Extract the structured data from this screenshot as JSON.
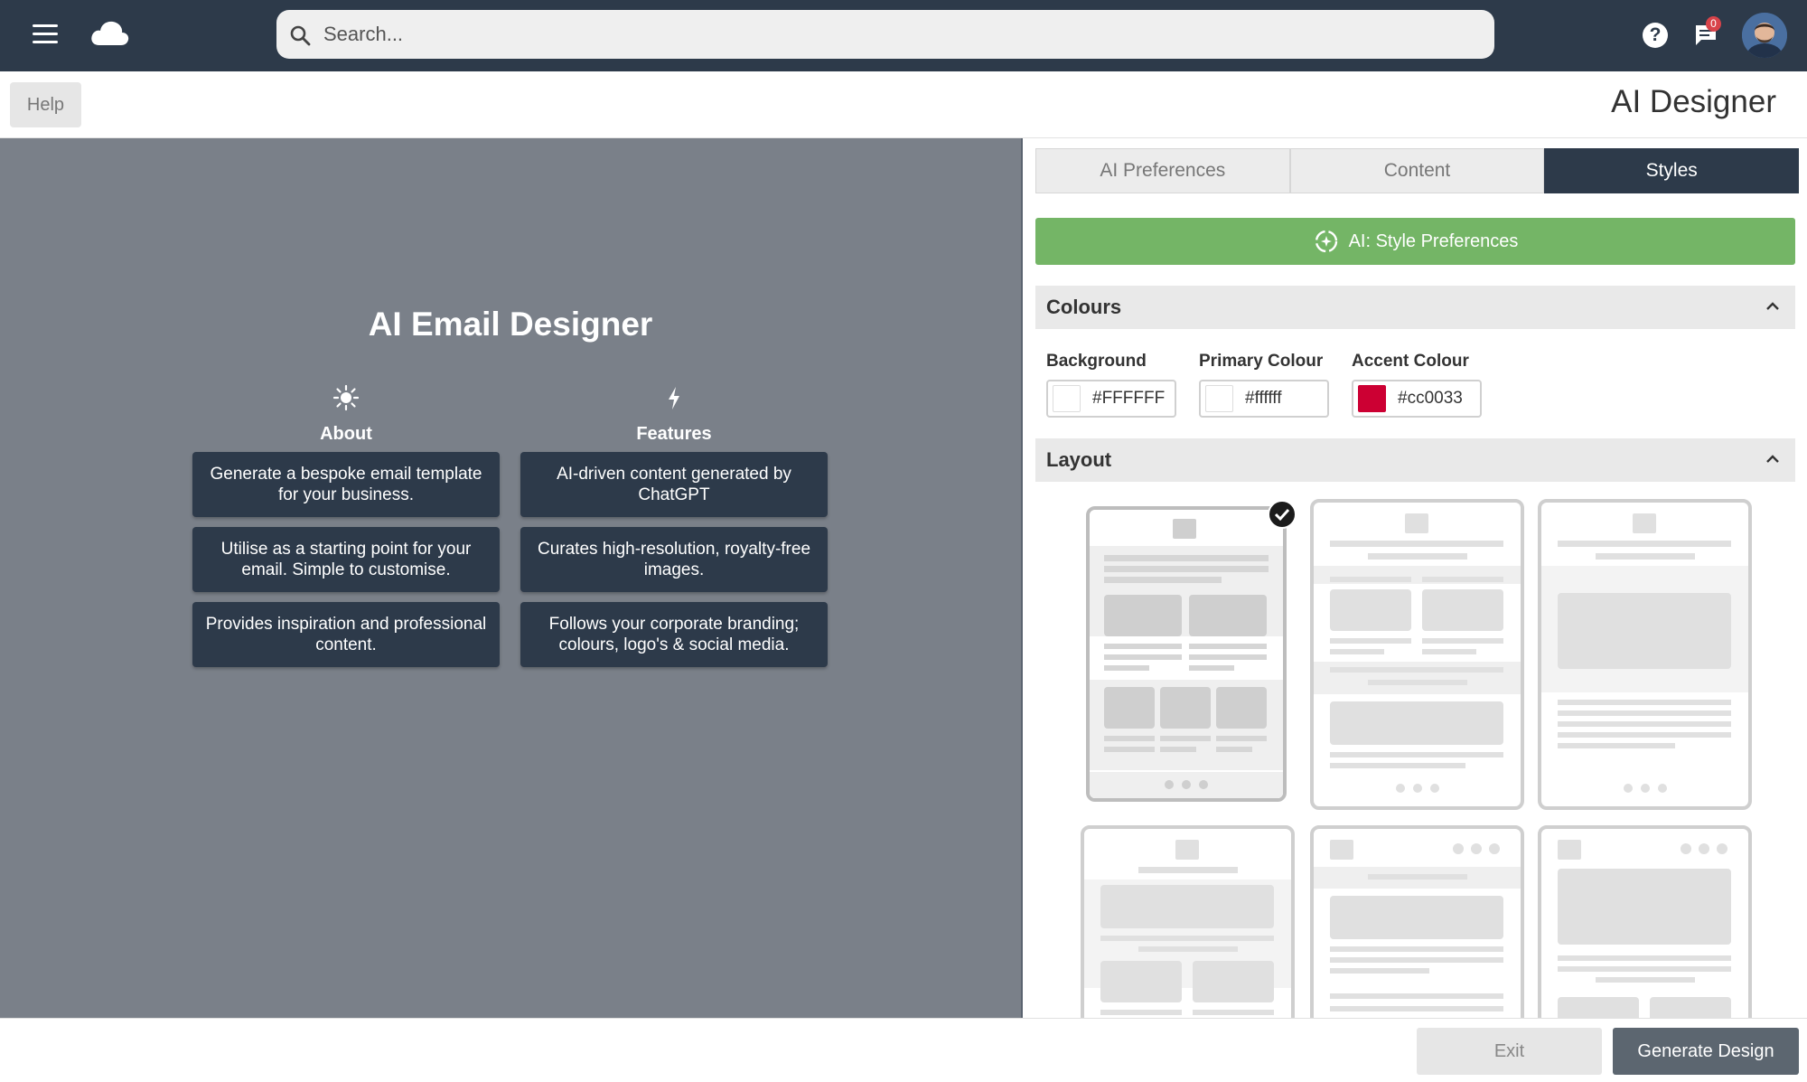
{
  "topbar": {
    "search_placeholder": "Search...",
    "help_glyph": "?",
    "notifications_count": "0",
    "icons": [
      "menu-icon",
      "cloud-logo-icon",
      "search-icon",
      "help-icon",
      "chat-icon",
      "avatar"
    ]
  },
  "subheader": {
    "help_label": "Help",
    "title": "AI Designer"
  },
  "preview": {
    "title": "AI Email Designer",
    "about": {
      "heading": "About",
      "icon": "sun-icon",
      "items": [
        "Generate a bespoke email template for your business.",
        "Utilise as a starting point for your email. Simple to customise.",
        "Provides inspiration and professional content."
      ]
    },
    "features": {
      "heading": "Features",
      "icon": "lightning-icon",
      "items": [
        "AI-driven content generated by ChatGPT",
        "Curates high-resolution, royalty-free images.",
        "Follows your corporate branding; colours, logo's & social media."
      ]
    }
  },
  "panel": {
    "tabs": [
      {
        "label": "AI Preferences",
        "active": false
      },
      {
        "label": "Content",
        "active": false
      },
      {
        "label": "Styles",
        "active": true
      }
    ],
    "ai_button_label": "AI: Style Preferences",
    "colours": {
      "heading": "Colours",
      "fields": [
        {
          "label": "Background",
          "value": "#FFFFFF",
          "swatch": "#FFFFFF"
        },
        {
          "label": "Primary Colour",
          "value": "#ffffff",
          "swatch": "#ffffff"
        },
        {
          "label": "Accent Colour",
          "value": "#cc0033",
          "swatch": "#cc0033"
        }
      ]
    },
    "layout": {
      "heading": "Layout",
      "selected_index": 0,
      "templates": [
        "two-column-grid-with-three-column-row",
        "two-column-grid-with-full-image",
        "single-hero-with-text",
        "hero-with-two-column-grid",
        "logo-with-social-header",
        "logo-with-social-hero"
      ]
    }
  },
  "footer": {
    "exit_label": "Exit",
    "generate_label": "Generate Design"
  },
  "colors": {
    "navbar": "#2d3a4a",
    "preview_bg": "#7a8089",
    "accent_green": "#74b566",
    "card_bg": "#2d3a4a"
  }
}
